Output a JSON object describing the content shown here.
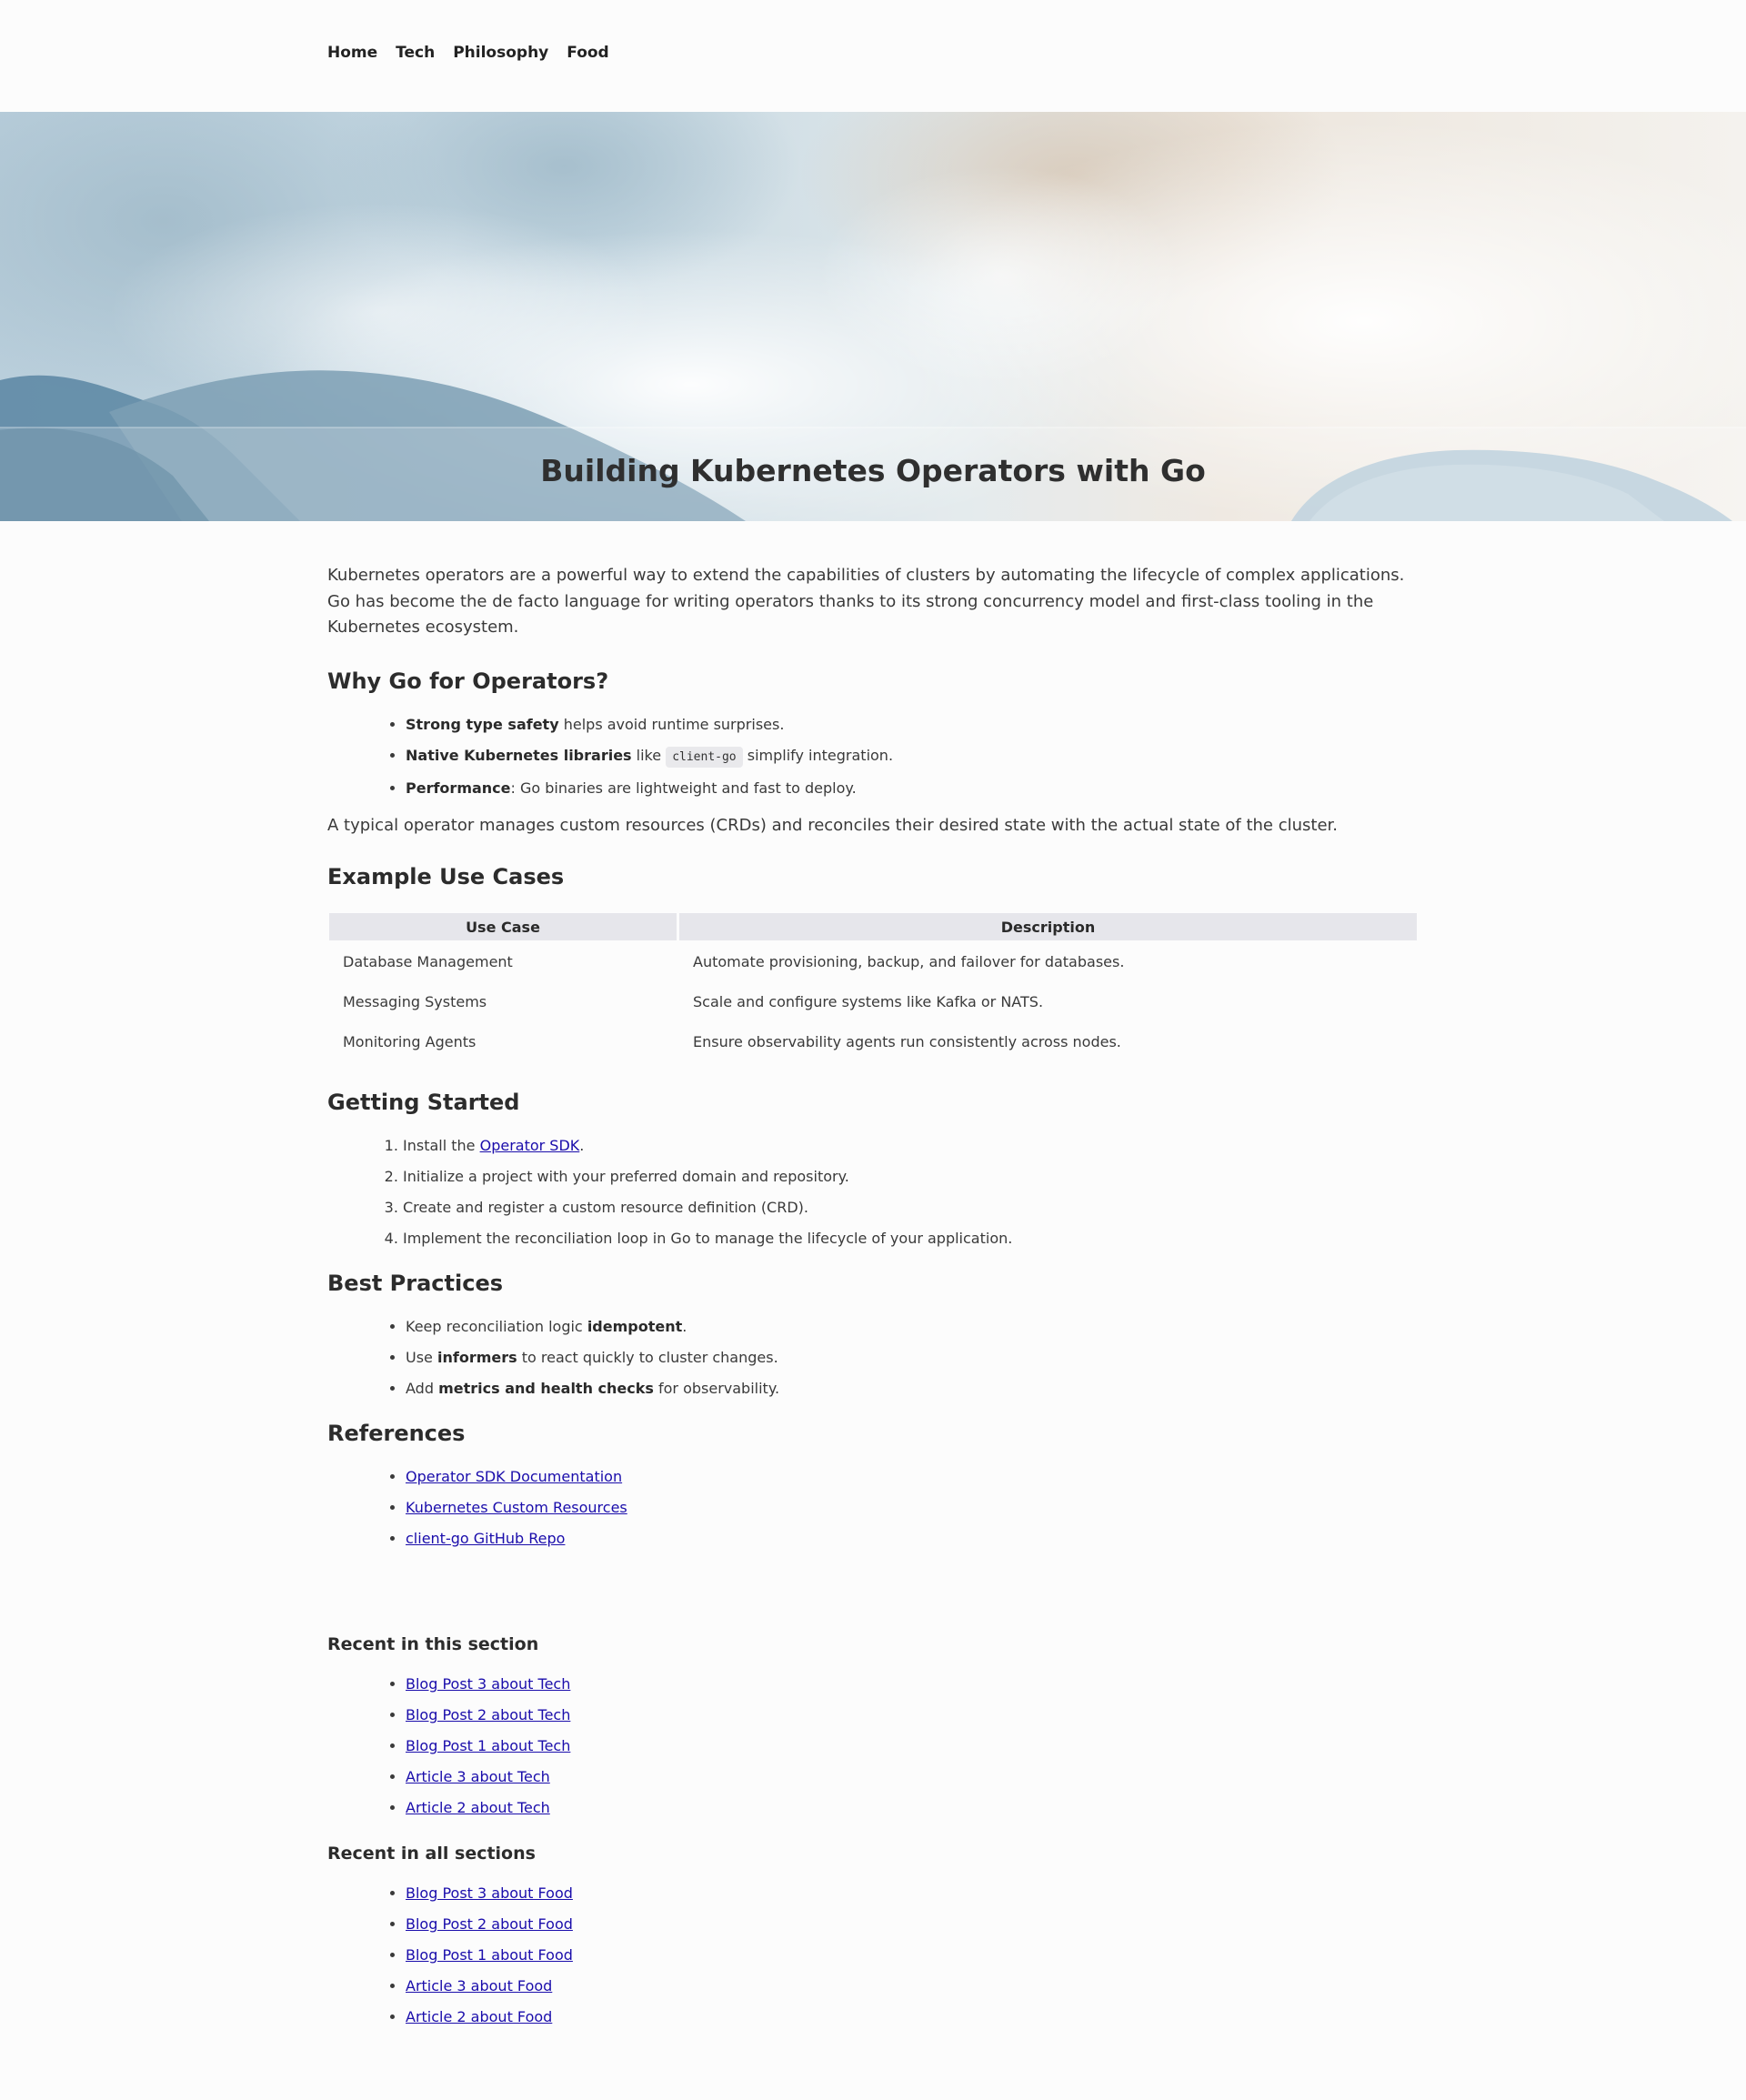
{
  "nav": {
    "items": [
      "Home",
      "Tech",
      "Philosophy",
      "Food"
    ]
  },
  "hero": {
    "title": "Building Kubernetes Operators with Go"
  },
  "article": {
    "intro": "Kubernetes operators are a powerful way to extend the capabilities of clusters by automating the lifecycle of complex applications. Go has become the de facto language for writing operators thanks to its strong concurrency model and first-class tooling in the Kubernetes ecosystem.",
    "why_heading": "Why Go for Operators?",
    "why": {
      "b1_bold": "Strong type safety",
      "b1_rest": " helps avoid runtime surprises.",
      "b2_bold": "Native Kubernetes libraries",
      "b2_mid": " like ",
      "b2_code": "client-go",
      "b2_rest": " simplify integration.",
      "b3_bold": "Performance",
      "b3_rest": ": Go binaries are lightweight and fast to deploy."
    },
    "crd_para": "A typical operator manages custom resources (CRDs) and reconciles their desired state with the actual state of the cluster.",
    "usecases_heading": "Example Use Cases",
    "table": {
      "headers": [
        "Use Case",
        "Description"
      ],
      "rows": [
        [
          "Database Management",
          "Automate provisioning, backup, and failover for databases."
        ],
        [
          "Messaging Systems",
          "Scale and configure systems like Kafka or NATS."
        ],
        [
          "Monitoring Agents",
          "Ensure observability agents run consistently across nodes."
        ]
      ]
    },
    "getting_started_heading": "Getting Started",
    "steps": {
      "s1_pre": "Install the ",
      "s1_link": "Operator SDK",
      "s1_post": ".",
      "s2": "Initialize a project with your preferred domain and repository.",
      "s3": "Create and register a custom resource definition (CRD).",
      "s4": "Implement the reconciliation loop in Go to manage the lifecycle of your application."
    },
    "best_heading": "Best Practices",
    "best": {
      "b1_pre": "Keep reconciliation logic ",
      "b1_bold": "idempotent",
      "b1_post": ".",
      "b2_pre": "Use ",
      "b2_bold": "informers",
      "b2_post": " to react quickly to cluster changes.",
      "b3_pre": "Add ",
      "b3_bold": "metrics and health checks",
      "b3_post": " for observability."
    },
    "refs_heading": "References",
    "refs": [
      "Operator SDK Documentation",
      "Kubernetes Custom Resources",
      "client-go GitHub Repo"
    ]
  },
  "recent_section": {
    "heading": "Recent in this section",
    "links": [
      "Blog Post 3 about Tech",
      "Blog Post 2 about Tech",
      "Blog Post 1 about Tech",
      "Article 3 about Tech",
      "Article 2 about Tech"
    ]
  },
  "recent_all": {
    "heading": "Recent in all sections",
    "links": [
      "Blog Post 3 about Food",
      "Blog Post 2 about Food",
      "Blog Post 1 about Food",
      "Article 3 about Food",
      "Article 2 about Food"
    ]
  },
  "colors": {
    "link": "#1a0dab",
    "text": "#333333",
    "background": "#fcfcfc",
    "table_header": "#e6e6eb"
  }
}
